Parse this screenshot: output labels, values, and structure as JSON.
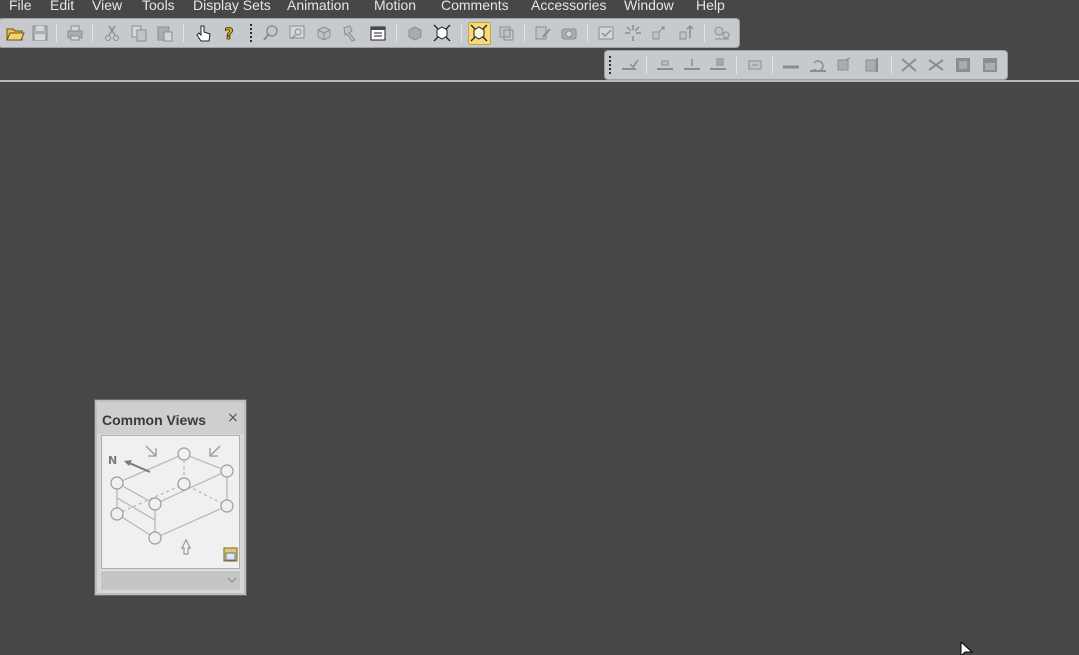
{
  "menubar": {
    "items": [
      "File",
      "Edit",
      "View",
      "Tools",
      "Display Sets",
      "Animation",
      "Motion",
      "Comments",
      "Accessories",
      "Window",
      "Help"
    ]
  },
  "toolbar_main": {
    "buttons": [
      {
        "icon": "open-folder-icon",
        "enabled": true
      },
      {
        "icon": "save-icon",
        "enabled": false
      },
      {
        "icon": "print-icon",
        "enabled": false
      },
      {
        "icon": "cut-icon",
        "enabled": false
      },
      {
        "icon": "copy-icon",
        "enabled": false
      },
      {
        "icon": "paste-icon",
        "enabled": false
      },
      {
        "icon": "pointer-hand-icon",
        "enabled": true
      },
      {
        "icon": "help-icon",
        "enabled": true
      },
      {
        "icon": "zoom-icon",
        "enabled": false
      },
      {
        "icon": "zoom-window-icon",
        "enabled": false
      },
      {
        "icon": "rotate-view-icon",
        "enabled": false
      },
      {
        "icon": "measure-icon",
        "enabled": false
      },
      {
        "icon": "properties-icon",
        "enabled": true
      },
      {
        "icon": "shaded-view-icon",
        "enabled": false
      },
      {
        "icon": "fit-all-icon",
        "enabled": true
      },
      {
        "icon": "selection-box-icon",
        "enabled": true,
        "active": true
      },
      {
        "icon": "sectioning-icon",
        "enabled": false
      },
      {
        "icon": "markup-icon",
        "enabled": false
      },
      {
        "icon": "camera-icon",
        "enabled": false
      },
      {
        "icon": "check-icon",
        "enabled": false
      },
      {
        "icon": "explode-icon",
        "enabled": false
      },
      {
        "icon": "transform-icon",
        "enabled": false
      },
      {
        "icon": "move-part-icon",
        "enabled": false
      },
      {
        "icon": "settings-icon",
        "enabled": false
      }
    ]
  },
  "toolbar_secondary": {
    "buttons": [
      {
        "icon": "measure-check-icon"
      },
      {
        "icon": "dimension-a-icon"
      },
      {
        "icon": "dimension-b-icon"
      },
      {
        "icon": "dimension-c-icon"
      },
      {
        "icon": "annotation-icon"
      },
      {
        "icon": "line-icon"
      },
      {
        "icon": "undo-dimension-icon"
      },
      {
        "icon": "surface-icon"
      },
      {
        "icon": "edge-icon"
      },
      {
        "icon": "scissors-a-icon"
      },
      {
        "icon": "scissors-b-icon"
      },
      {
        "icon": "block-a-icon"
      },
      {
        "icon": "block-b-icon"
      }
    ]
  },
  "common_views": {
    "title": "Common Views",
    "close_symbol": "×",
    "north_label": "N"
  },
  "colors": {
    "background": "#474747",
    "toolbar": "#c6c9cd",
    "menu_text": "#e6e6e6",
    "active_button": "#f7d87a"
  }
}
